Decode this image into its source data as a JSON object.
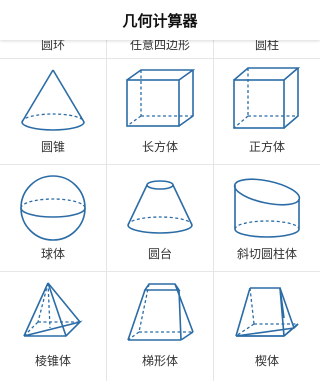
{
  "header": {
    "title": "几何计算器"
  },
  "peek_labels": [
    "圆环",
    "任意四边形",
    "圆柱"
  ],
  "shapes": [
    {
      "label": "圆锥",
      "icon": "cone-icon"
    },
    {
      "label": "长方体",
      "icon": "cuboid-icon"
    },
    {
      "label": "正方体",
      "icon": "cube-icon"
    },
    {
      "label": "球体",
      "icon": "sphere-icon"
    },
    {
      "label": "圆台",
      "icon": "frustum-icon"
    },
    {
      "label": "斜切圆柱体",
      "icon": "oblique-cylinder-icon"
    },
    {
      "label": "棱锥体",
      "icon": "pyramid-icon"
    },
    {
      "label": "梯形体",
      "icon": "trapezoid-prism-icon"
    },
    {
      "label": "楔体",
      "icon": "wedge-icon"
    }
  ],
  "colors": {
    "line": "#2b6ca6",
    "divider": "#e6e6e6"
  }
}
